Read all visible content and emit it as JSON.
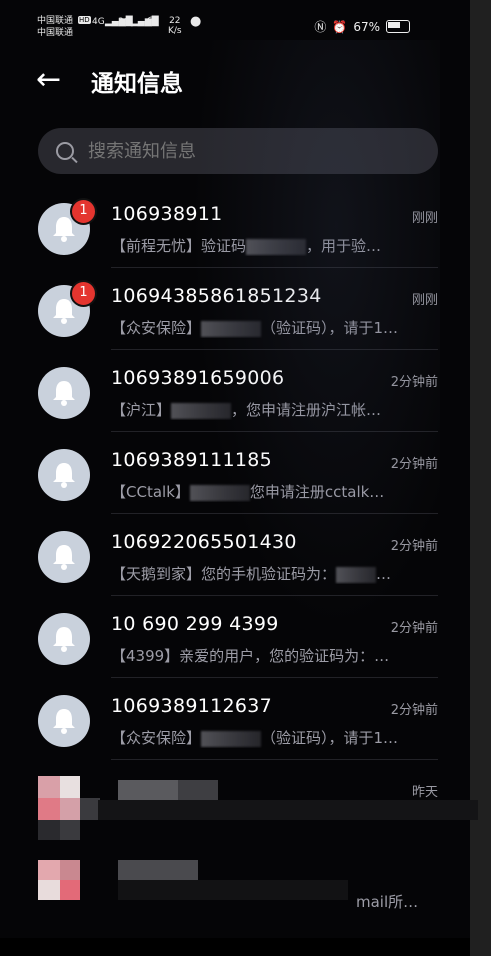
{
  "status": {
    "carrier1": "中国联通",
    "carrier2": "中国联通",
    "hd": "HD",
    "sig1": "4G",
    "sig2": "3G",
    "speed": "22",
    "speed_unit": "K/s",
    "battery": "67%"
  },
  "header": {
    "title": "通知信息"
  },
  "search": {
    "placeholder": "搜索通知信息"
  },
  "messages": [
    {
      "sender": "106938911",
      "time": "刚刚",
      "pre": "【前程无忧】验证码",
      "post": "，用于验…",
      "badge": "1"
    },
    {
      "sender": "10694385861851234",
      "time": "刚刚",
      "pre": "【众安保险】",
      "post": "（验证码），请于1…",
      "badge": "1"
    },
    {
      "sender": "10693891659006",
      "time": "2分钟前",
      "pre": "【沪江】",
      "post": "，您申请注册沪江帐…",
      "badge": ""
    },
    {
      "sender": "1069389111185",
      "time": "2分钟前",
      "pre": "【CCtalk】",
      "post": "您申请注册cctalk…",
      "badge": ""
    },
    {
      "sender": "106922065501430",
      "time": "2分钟前",
      "pre": "【天鹅到家】您的手机验证码为：",
      "post": "…",
      "badge": ""
    },
    {
      "sender": "10 690 299 4399",
      "time": "2分钟前",
      "pre": "【4399】亲爱的用户，您的验证码为：…",
      "post": "",
      "badge": ""
    },
    {
      "sender": "1069389112637",
      "time": "2分钟前",
      "pre": "【众安保险】",
      "post": "（验证码），请于1…",
      "badge": ""
    }
  ],
  "redacted": {
    "time": "昨天",
    "tail": "mail所…"
  },
  "colors": {
    "background": "#050507",
    "badge": "#e4352f",
    "avatar": "#c9d1dc",
    "secondary_text": "#9d9da7"
  },
  "icons": {
    "back": "arrow-left-icon",
    "search": "search-icon",
    "avatar": "bell-icon"
  }
}
